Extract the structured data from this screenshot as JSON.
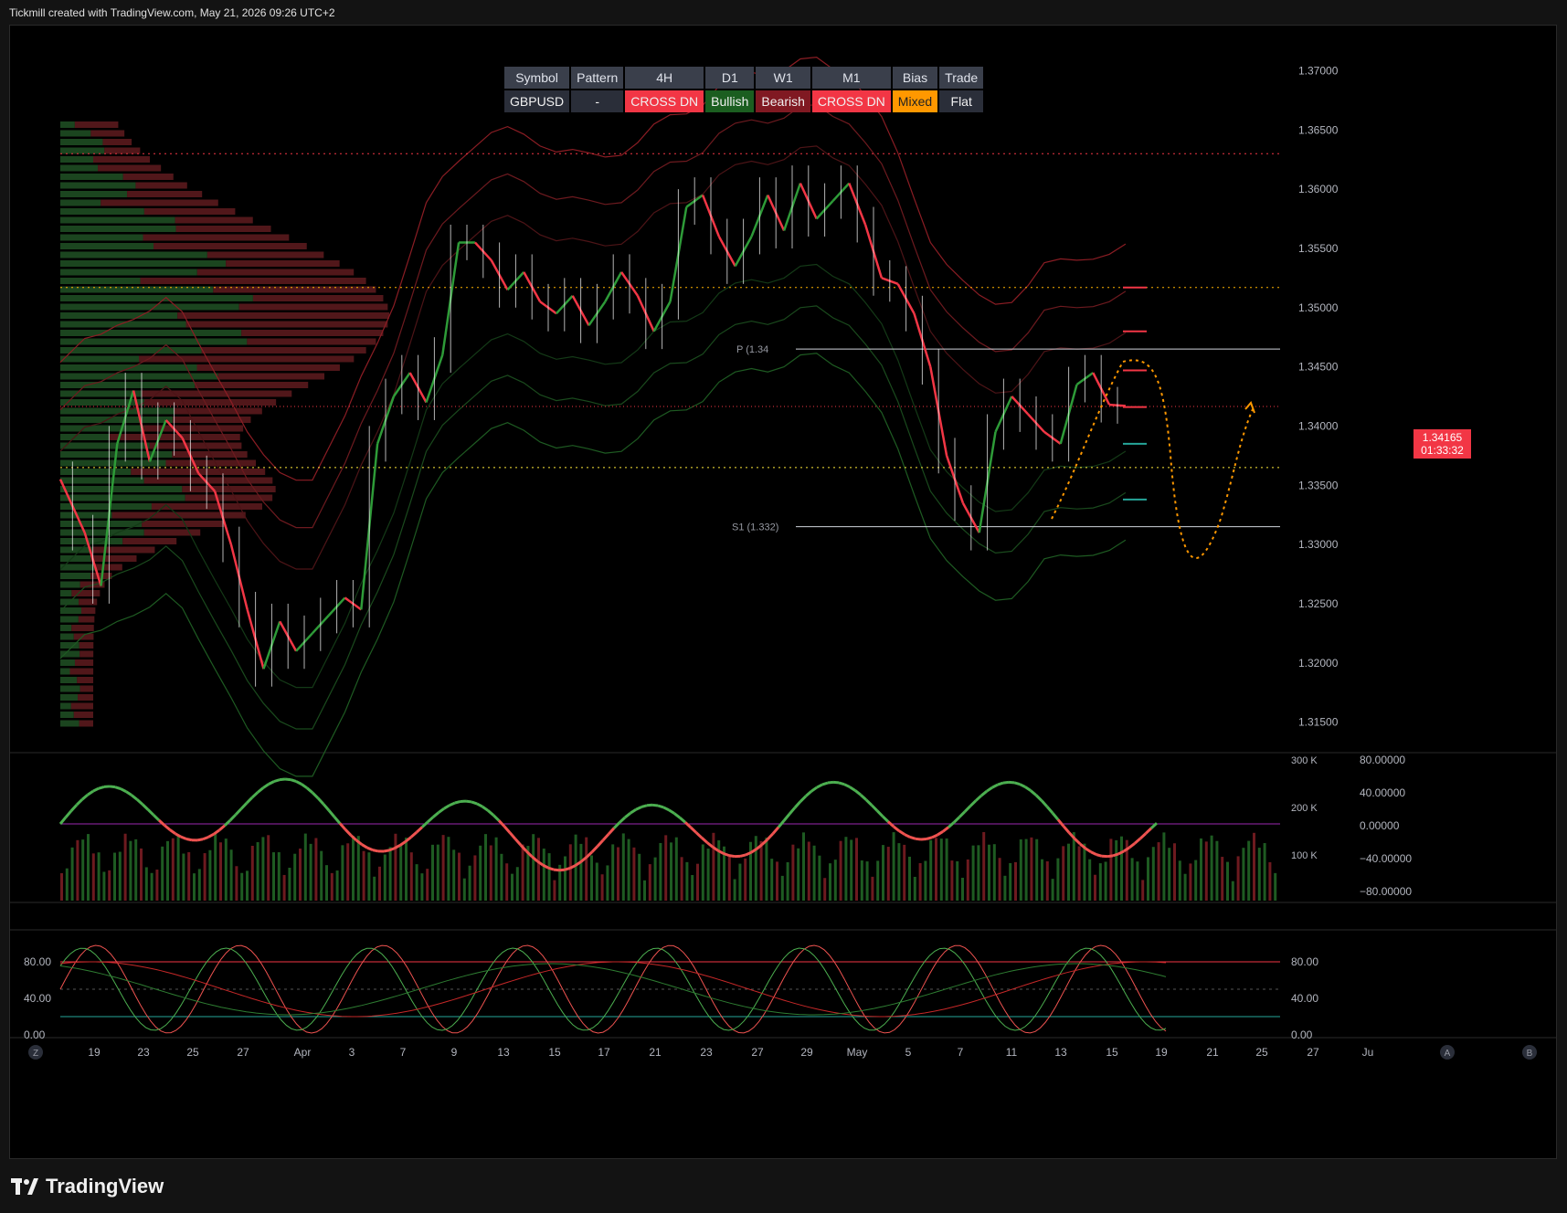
{
  "header": {
    "caption": "Tickmill created with TradingView.com, May 21, 2026 09:26 UTC+2"
  },
  "footer": {
    "brand": "TradingView"
  },
  "table": {
    "headers": [
      "Symbol",
      "Pattern",
      "4H",
      "D1",
      "W1",
      "M1",
      "Bias",
      "Trade"
    ],
    "row": [
      {
        "text": "GBPUSD",
        "color": "#2a2e39"
      },
      {
        "text": "-",
        "color": "#2a2e39"
      },
      {
        "text": "CROSS DN",
        "color": "#f23645"
      },
      {
        "text": "Bullish",
        "color": "#1b5e20"
      },
      {
        "text": "Bearish",
        "color": "#801922"
      },
      {
        "text": "CROSS DN",
        "color": "#f23645"
      },
      {
        "text": "Mixed",
        "color": "#ff9800"
      },
      {
        "text": "Flat",
        "color": "#2a2e39"
      }
    ]
  },
  "price_tag": {
    "price": "1.34165",
    "countdown": "01:33:32"
  },
  "levels": {
    "pivot_label": "P (1.34",
    "s1_label": "S1 (1.332)"
  },
  "bottom_bar_buttons": {
    "left": "Z",
    "a": "A",
    "b": "B"
  },
  "chart_data": {
    "type": "line",
    "symbol": "GBPUSD",
    "main_price_axis": {
      "ticks": [
        "1.37000",
        "1.36500",
        "1.36000",
        "1.35500",
        "1.35000",
        "1.34500",
        "1.34000",
        "1.33500",
        "1.33000",
        "1.32500",
        "1.32000",
        "1.31500"
      ],
      "ylim": [
        1.3125,
        1.3715
      ]
    },
    "x_axis_ticks": [
      "19",
      "23",
      "25",
      "27",
      "Apr",
      "3",
      "7",
      "9",
      "13",
      "15",
      "17",
      "21",
      "23",
      "27",
      "29",
      "May",
      "5",
      "7",
      "11",
      "13",
      "15",
      "19",
      "21",
      "25",
      "27",
      "Ju"
    ],
    "price_series": {
      "name": "GBPUSD",
      "x": [
        0,
        6,
        10,
        14,
        18,
        22,
        26,
        30,
        34,
        38,
        42,
        46,
        50,
        54,
        58,
        62,
        66,
        70,
        74,
        78,
        82,
        86,
        90,
        94,
        98,
        102,
        106,
        110,
        114,
        118,
        122,
        126,
        130,
        134,
        138,
        142,
        146,
        150,
        154,
        158,
        162,
        166,
        170,
        174,
        178,
        182,
        186,
        190,
        194,
        198,
        202,
        206,
        210,
        214,
        218,
        222,
        226,
        230,
        234,
        238,
        242,
        246,
        250,
        254,
        258,
        262
      ],
      "y": [
        1.3355,
        1.331,
        1.3265,
        1.3385,
        1.343,
        1.337,
        1.3405,
        1.339,
        1.336,
        1.3345,
        1.33,
        1.3245,
        1.3195,
        1.3235,
        1.321,
        1.3225,
        1.324,
        1.3255,
        1.3245,
        1.3385,
        1.3425,
        1.3445,
        1.342,
        1.346,
        1.3555,
        1.3555,
        1.354,
        1.3515,
        1.353,
        1.3505,
        1.3495,
        1.351,
        1.3485,
        1.3505,
        1.353,
        1.351,
        1.348,
        1.3505,
        1.3585,
        1.3595,
        1.356,
        1.3535,
        1.356,
        1.3595,
        1.3565,
        1.3605,
        1.3575,
        1.359,
        1.3605,
        1.357,
        1.3525,
        1.352,
        1.3495,
        1.345,
        1.3375,
        1.3335,
        1.331,
        1.3395,
        1.3425,
        1.341,
        1.3395,
        1.3385,
        1.3435,
        1.3445,
        1.3418,
        1.3417
      ]
    },
    "levels": {
      "pivot": 1.3465,
      "s1": 1.3315,
      "dotted_red": 1.363,
      "dotted_yellow_top": 1.3517,
      "dotted_yellow_bottom": 1.3365,
      "last_price": 1.34165
    },
    "volume_axis": {
      "ticks": [
        "300 K",
        "200 K",
        "100 K"
      ]
    },
    "oscillator_axis": {
      "ticks": [
        "80.00000",
        "40.00000",
        "0.00000",
        "−40.00000",
        "−80.00000"
      ]
    },
    "stochastic_axis": {
      "left_ticks": [
        "80.00",
        "40.00",
        "0.00"
      ],
      "right_ticks": [
        "80.00",
        "40.00",
        "0.00"
      ]
    },
    "colors": {
      "up": "#26a69a",
      "bull": "#2e7d32",
      "bear": "#f23645",
      "forecast": "#ff9800",
      "osc_zero": "#9c27b0"
    }
  }
}
